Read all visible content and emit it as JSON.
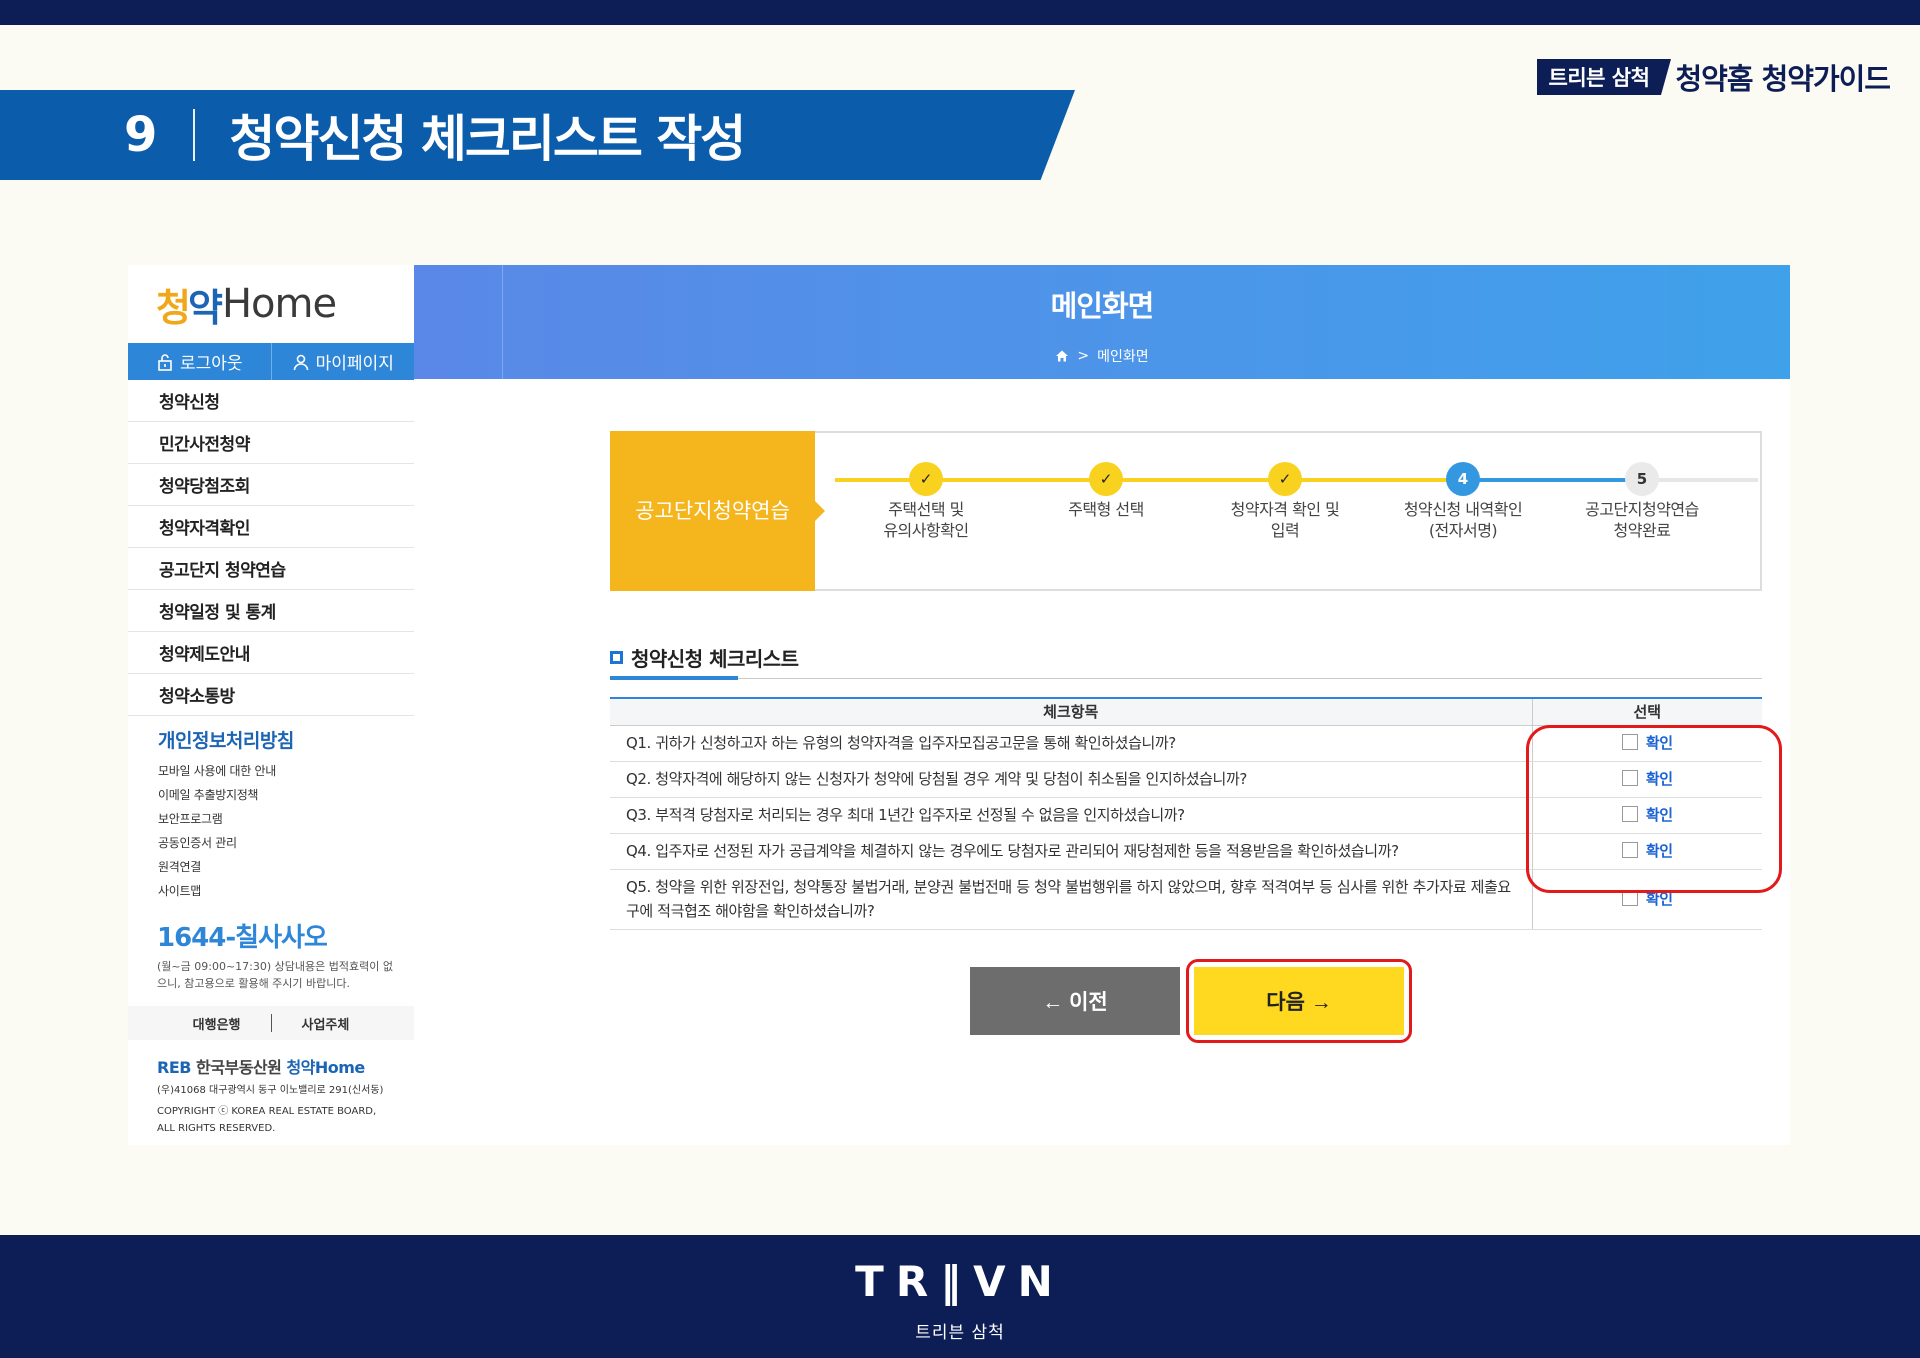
{
  "slide": {
    "number": "9",
    "title": "청약신청 체크리스트 작성",
    "brand_badge": "트리븐 삼척",
    "guide_title": "청약홈 청약가이드"
  },
  "sidebar": {
    "logo_hangul_mark": "청",
    "logo_hangul": "약",
    "logo_home": "Home",
    "logout": "로그아웃",
    "mypage": "마이페이지",
    "menu": [
      "청약신청",
      "민간사전청약",
      "청약당첨조회",
      "청약자격확인",
      "공고단지 청약연습",
      "청약일정 및 통계",
      "청약제도안내",
      "청약소통방"
    ],
    "privacy_title": "개인정보처리방침",
    "privacy_links": [
      "모바일 사용에 대한 안내",
      "이메일 추출방지정책",
      "보안프로그램",
      "공동인증서 관리",
      "원격연결",
      "사이트맵"
    ],
    "phone_prefix": "1644-",
    "phone_word": "칠사사오",
    "phone_desc": "(월~금 09:00~17:30) 상담내용은 법적효력이 없으니, 참고용으로 활용해 주시기 바랍니다.",
    "link_bank": "대행은행",
    "link_business": "사업주체",
    "reb_logo_mark": "REB",
    "reb_logo_org": "한국부동산원",
    "reb_logo_site": "청약Home",
    "reb_address": "(우)41068 대구광역시 동구 이노밸리로 291(신서동)",
    "copyright": "COPYRIGHT ⓒ KOREA REAL ESTATE BOARD, ALL RIGHTS RESERVED."
  },
  "header": {
    "title": "메인화면",
    "breadcrumb": "메인화면"
  },
  "steps": {
    "label_line1": "공고단지",
    "label_line2": "청약연습",
    "items": [
      {
        "marker": "✓",
        "state": "done",
        "line1": "주택선택 및",
        "line2": "유의사항확인"
      },
      {
        "marker": "✓",
        "state": "done",
        "line1": "주택형 선택",
        "line2": ""
      },
      {
        "marker": "✓",
        "state": "done",
        "line1": "청약자격 확인 및",
        "line2": "입력"
      },
      {
        "marker": "4",
        "state": "current",
        "line1": "청약신청 내역확인",
        "line2": "(전자서명)"
      },
      {
        "marker": "5",
        "state": "next",
        "line1": "공고단지청약연습",
        "line2": "청약완료"
      }
    ]
  },
  "checklist": {
    "title": "청약신청 체크리스트",
    "col_item": "체크항목",
    "col_select": "선택",
    "confirm_label": "확인",
    "questions": [
      "Q1. 귀하가 신청하고자 하는 유형의 청약자격을 입주자모집공고문을 통해 확인하셨습니까?",
      "Q2. 청약자격에 해당하지 않는 신청자가 청약에 당첨될 경우 계약 및 당첨이 취소됨을 인지하셨습니까?",
      "Q3. 부적격 당첨자로 처리되는 경우 최대 1년간 입주자로 선정될 수 없음을 인지하셨습니까?",
      "Q4. 입주자로 선정된 자가 공급계약을 체결하지 않는 경우에도 당첨자로 관리되어 재당첨제한 등을 적용받음을 확인하셨습니까?",
      "Q5. 청약을 위한 위장전입, 청약통장 불법거래, 분양권 불법전매 등 청약 불법행위를 하지 않았으며, 향후 적격여부 등 심사를 위한 추가자료 제출요구에 적극협조 해야함을 확인하셨습니까?"
    ]
  },
  "buttons": {
    "prev": "← 이전",
    "next": "다음 →"
  },
  "footer": {
    "logo": "TR‖VN",
    "subtitle": "트리븐 삼척"
  },
  "colors": {
    "navy": "#0d1d55",
    "title_blue": "#0b5cab",
    "accent_blue": "#2e86d8",
    "step_yellow": "#f5b51d",
    "next_yellow": "#ffd91f",
    "highlight_red": "#e21a1a"
  }
}
